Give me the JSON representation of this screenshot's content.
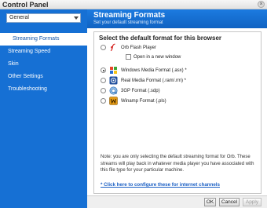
{
  "window": {
    "title": "Control Panel"
  },
  "sidebar": {
    "category_select": {
      "value": "General"
    },
    "items": [
      {
        "label": "Streaming Formats",
        "active": true
      },
      {
        "label": "Streaming Speed",
        "active": false
      },
      {
        "label": "Skin",
        "active": false
      },
      {
        "label": "Other Settings",
        "active": false
      },
      {
        "label": "Troubleshooting",
        "active": false
      }
    ]
  },
  "header": {
    "title": "Streaming Formats",
    "subtitle": "Set your default streaming format"
  },
  "panel": {
    "heading": "Select the default format for this browser",
    "options": [
      {
        "label": "Orb Flash Player",
        "icon": "flash-icon",
        "selected": false
      },
      {
        "label": "Windows Media Format (.asx) *",
        "icon": "windows-media-icon",
        "selected": true
      },
      {
        "label": "Real Media Format (.ram/.rm) *",
        "icon": "real-media-icon",
        "selected": false
      },
      {
        "label": "3GP Format (.sdp)",
        "icon": "quicktime-icon",
        "selected": false
      },
      {
        "label": "Winamp Format (.pls)",
        "icon": "winamp-icon",
        "selected": false
      }
    ],
    "new_window_label": "Open in a new window",
    "new_window_checked": false,
    "note": "Note: you are only selecting the default streaming format for Orb. These streams will play back in whatever media player you have associated with this file type for your particular machine.",
    "link_text": "* Click here to configure these for internet channels"
  },
  "footer": {
    "ok": "OK",
    "cancel": "Cancel",
    "apply": "Apply"
  },
  "colors": {
    "sidebar": "#1670d4",
    "accent_text": "#1455a8",
    "link": "#1a5fc4"
  }
}
